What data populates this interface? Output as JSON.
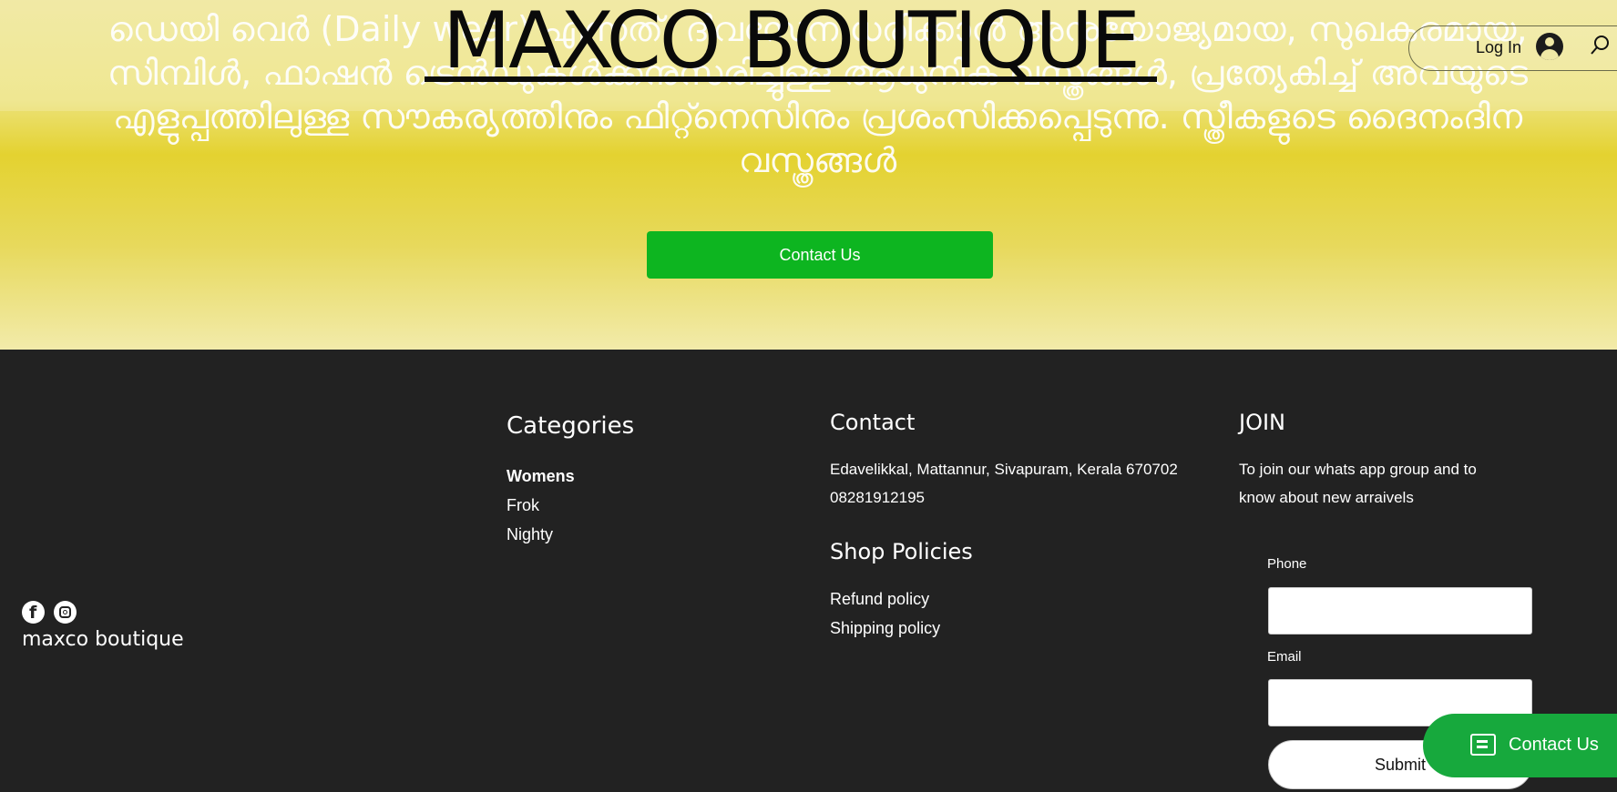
{
  "hero": {
    "description": "ഡെയി വെർ (Daily wear) എന്നത്, ദിവസേന ധരിക്കാൻ അനുയോജ്യമായ, സുഖകരമായ, സിമ്പിൾ, ഫാഷൻ ട്രെൻഡുകൾക്കനുസരിച്ചുള്ള ആധുനിക വസ്ത്രങ്ങൾ, പ്രത്യേകിച്ച് അവയുടെ എളുപ്പത്തിലുള്ള സൗകര്യത്തിനും ഫിറ്റ്നെസിനും പ്രശംസിക്കപ്പെടുന്നു. സ്ത്രീകളുടെ ദൈനംദിന വസ്ത്രങ്ങൾ",
    "brand_title": "MAXCO BOUTIQUE",
    "contact_button": "Contact Us",
    "bg_color": "#e4d230",
    "button_color": "#0db520"
  },
  "header": {
    "login_label": "Log In",
    "avatar_icon": "user-avatar-icon",
    "search_icon": "search-icon"
  },
  "footer": {
    "social": [
      "facebook-icon",
      "instagram-icon"
    ],
    "brand_name": "maxco boutique",
    "categories": {
      "title": "Categories",
      "items": [
        "Womens",
        "Frok",
        "Nighty"
      ]
    },
    "contact": {
      "title": "Contact",
      "address": "Edavelikkal, Mattannur, Sivapuram, Kerala 670702",
      "phone": "08281912195"
    },
    "policies": {
      "title": "Shop Policies",
      "items": [
        "Refund policy",
        "Shipping policy"
      ]
    },
    "join": {
      "title": "JOIN",
      "line1": "To join our whats app group and to",
      "line2": "know about new arraivels",
      "phone_label": "Phone",
      "email_label": "Email",
      "submit_label": "Submit"
    }
  },
  "chat": {
    "label": "Contact Us",
    "color": "#17a93d"
  }
}
